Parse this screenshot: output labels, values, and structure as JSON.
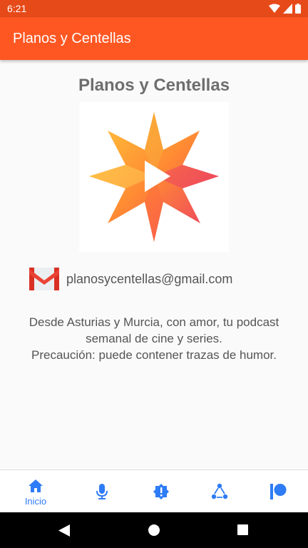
{
  "status_bar": {
    "time": "6:21"
  },
  "app_bar": {
    "title": "Planos y Centellas"
  },
  "main": {
    "title": "Planos y Centellas",
    "email": "planosycentellas@gmail.com",
    "description_lines": [
      "Desde Asturias y Murcia, con amor, tu podcast",
      "semanal de cine y series.",
      "Precaución: puede contener trazas de humor."
    ]
  },
  "bottom_nav": {
    "items": [
      {
        "label": "Inicio",
        "icon": "home-icon",
        "active": true
      },
      {
        "label": "",
        "icon": "microphone-icon",
        "active": false
      },
      {
        "label": "",
        "icon": "alert-badge-icon",
        "active": false
      },
      {
        "label": "",
        "icon": "share-icon",
        "active": false
      },
      {
        "label": "",
        "icon": "patreon-icon",
        "active": false
      }
    ]
  },
  "colors": {
    "status_bar": "#e64a19",
    "app_bar": "#ff5722",
    "accent": "#2e7cf6",
    "text_gray": "#555555"
  }
}
